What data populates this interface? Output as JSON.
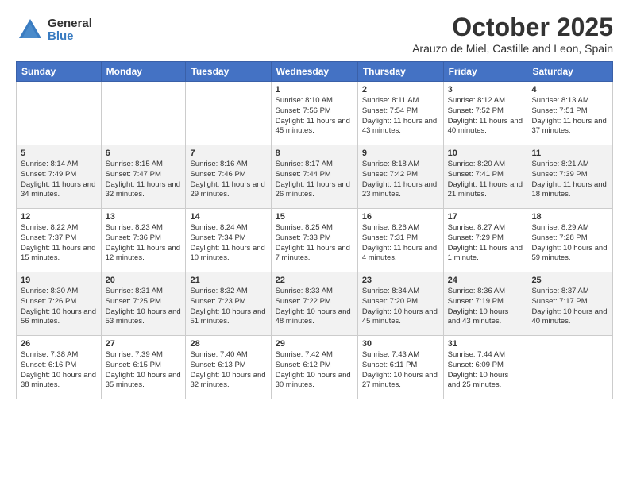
{
  "logo": {
    "general": "General",
    "blue": "Blue"
  },
  "header": {
    "month": "October 2025",
    "location": "Arauzo de Miel, Castille and Leon, Spain"
  },
  "weekdays": [
    "Sunday",
    "Monday",
    "Tuesday",
    "Wednesday",
    "Thursday",
    "Friday",
    "Saturday"
  ],
  "weeks": [
    [
      {
        "day": "",
        "info": ""
      },
      {
        "day": "",
        "info": ""
      },
      {
        "day": "",
        "info": ""
      },
      {
        "day": "1",
        "info": "Sunrise: 8:10 AM\nSunset: 7:56 PM\nDaylight: 11 hours\nand 45 minutes."
      },
      {
        "day": "2",
        "info": "Sunrise: 8:11 AM\nSunset: 7:54 PM\nDaylight: 11 hours\nand 43 minutes."
      },
      {
        "day": "3",
        "info": "Sunrise: 8:12 AM\nSunset: 7:52 PM\nDaylight: 11 hours\nand 40 minutes."
      },
      {
        "day": "4",
        "info": "Sunrise: 8:13 AM\nSunset: 7:51 PM\nDaylight: 11 hours\nand 37 minutes."
      }
    ],
    [
      {
        "day": "5",
        "info": "Sunrise: 8:14 AM\nSunset: 7:49 PM\nDaylight: 11 hours\nand 34 minutes."
      },
      {
        "day": "6",
        "info": "Sunrise: 8:15 AM\nSunset: 7:47 PM\nDaylight: 11 hours\nand 32 minutes."
      },
      {
        "day": "7",
        "info": "Sunrise: 8:16 AM\nSunset: 7:46 PM\nDaylight: 11 hours\nand 29 minutes."
      },
      {
        "day": "8",
        "info": "Sunrise: 8:17 AM\nSunset: 7:44 PM\nDaylight: 11 hours\nand 26 minutes."
      },
      {
        "day": "9",
        "info": "Sunrise: 8:18 AM\nSunset: 7:42 PM\nDaylight: 11 hours\nand 23 minutes."
      },
      {
        "day": "10",
        "info": "Sunrise: 8:20 AM\nSunset: 7:41 PM\nDaylight: 11 hours\nand 21 minutes."
      },
      {
        "day": "11",
        "info": "Sunrise: 8:21 AM\nSunset: 7:39 PM\nDaylight: 11 hours\nand 18 minutes."
      }
    ],
    [
      {
        "day": "12",
        "info": "Sunrise: 8:22 AM\nSunset: 7:37 PM\nDaylight: 11 hours\nand 15 minutes."
      },
      {
        "day": "13",
        "info": "Sunrise: 8:23 AM\nSunset: 7:36 PM\nDaylight: 11 hours\nand 12 minutes."
      },
      {
        "day": "14",
        "info": "Sunrise: 8:24 AM\nSunset: 7:34 PM\nDaylight: 11 hours\nand 10 minutes."
      },
      {
        "day": "15",
        "info": "Sunrise: 8:25 AM\nSunset: 7:33 PM\nDaylight: 11 hours\nand 7 minutes."
      },
      {
        "day": "16",
        "info": "Sunrise: 8:26 AM\nSunset: 7:31 PM\nDaylight: 11 hours\nand 4 minutes."
      },
      {
        "day": "17",
        "info": "Sunrise: 8:27 AM\nSunset: 7:29 PM\nDaylight: 11 hours\nand 1 minute."
      },
      {
        "day": "18",
        "info": "Sunrise: 8:29 AM\nSunset: 7:28 PM\nDaylight: 10 hours\nand 59 minutes."
      }
    ],
    [
      {
        "day": "19",
        "info": "Sunrise: 8:30 AM\nSunset: 7:26 PM\nDaylight: 10 hours\nand 56 minutes."
      },
      {
        "day": "20",
        "info": "Sunrise: 8:31 AM\nSunset: 7:25 PM\nDaylight: 10 hours\nand 53 minutes."
      },
      {
        "day": "21",
        "info": "Sunrise: 8:32 AM\nSunset: 7:23 PM\nDaylight: 10 hours\nand 51 minutes."
      },
      {
        "day": "22",
        "info": "Sunrise: 8:33 AM\nSunset: 7:22 PM\nDaylight: 10 hours\nand 48 minutes."
      },
      {
        "day": "23",
        "info": "Sunrise: 8:34 AM\nSunset: 7:20 PM\nDaylight: 10 hours\nand 45 minutes."
      },
      {
        "day": "24",
        "info": "Sunrise: 8:36 AM\nSunset: 7:19 PM\nDaylight: 10 hours\nand 43 minutes."
      },
      {
        "day": "25",
        "info": "Sunrise: 8:37 AM\nSunset: 7:17 PM\nDaylight: 10 hours\nand 40 minutes."
      }
    ],
    [
      {
        "day": "26",
        "info": "Sunrise: 7:38 AM\nSunset: 6:16 PM\nDaylight: 10 hours\nand 38 minutes."
      },
      {
        "day": "27",
        "info": "Sunrise: 7:39 AM\nSunset: 6:15 PM\nDaylight: 10 hours\nand 35 minutes."
      },
      {
        "day": "28",
        "info": "Sunrise: 7:40 AM\nSunset: 6:13 PM\nDaylight: 10 hours\nand 32 minutes."
      },
      {
        "day": "29",
        "info": "Sunrise: 7:42 AM\nSunset: 6:12 PM\nDaylight: 10 hours\nand 30 minutes."
      },
      {
        "day": "30",
        "info": "Sunrise: 7:43 AM\nSunset: 6:11 PM\nDaylight: 10 hours\nand 27 minutes."
      },
      {
        "day": "31",
        "info": "Sunrise: 7:44 AM\nSunset: 6:09 PM\nDaylight: 10 hours\nand 25 minutes."
      },
      {
        "day": "",
        "info": ""
      }
    ]
  ]
}
